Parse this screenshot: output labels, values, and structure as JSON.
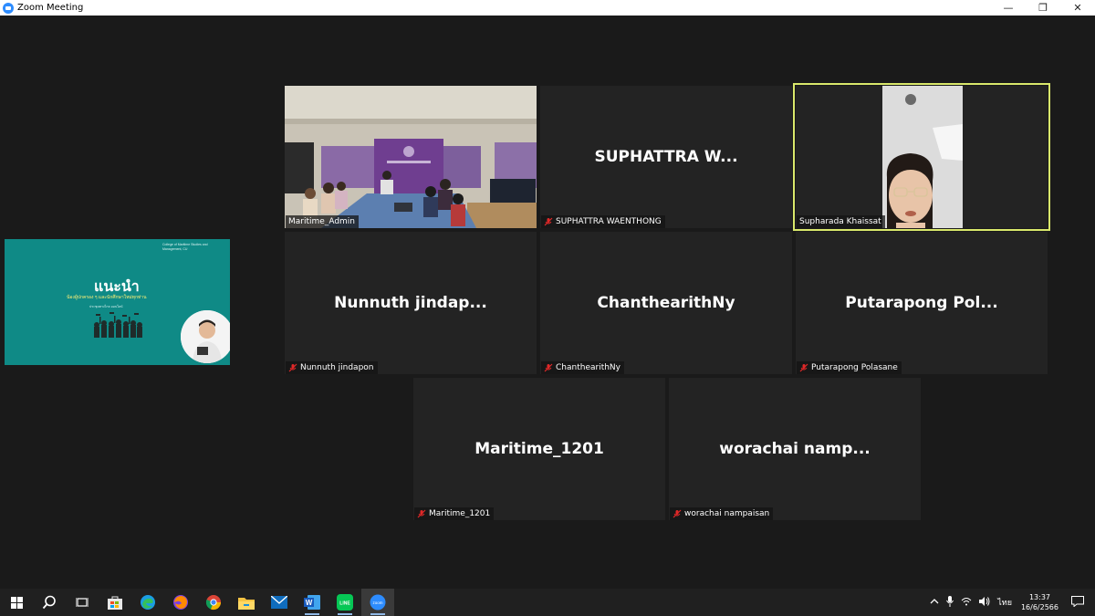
{
  "window": {
    "title": "Zoom Meeting",
    "minimize": "—",
    "restore": "❐",
    "close": "✕"
  },
  "shared_screen": {
    "org_text": "College of Maritime Studies and Management, CU",
    "heading": "แนะนำ",
    "subtitle": "น้องผู้ปกครอง ๆ และนักศึกษาใหม่ทุกท่าน",
    "small_text": "ประชุมทางไกล ออนไลน์"
  },
  "participants": [
    {
      "display": "",
      "name": "Maritime_Admin",
      "muted": false,
      "video": true
    },
    {
      "display": "SUPHATTRA  W...",
      "name": "SUPHATTRA WAENTHONG",
      "muted": true,
      "video": false
    },
    {
      "display": "",
      "name": "Supharada Khaissat",
      "muted": false,
      "video": true,
      "active": true
    },
    {
      "display": "Nunnuth  jindap...",
      "name": "Nunnuth jindapon",
      "muted": true,
      "video": false
    },
    {
      "display": "ChanthearithNy",
      "name": "ChanthearithNy",
      "muted": true,
      "video": false
    },
    {
      "display": "Putarapong  Pol...",
      "name": "Putarapong Polasane",
      "muted": true,
      "video": false
    },
    {
      "display": "Maritime_1201",
      "name": "Maritime_1201",
      "muted": true,
      "video": false
    },
    {
      "display": "worachai  namp...",
      "name": "worachai nampaisan",
      "muted": true,
      "video": false
    }
  ],
  "taskbar": {
    "icons": [
      "windows-start-icon",
      "search-icon",
      "task-view-icon",
      "store-icon",
      "edge-icon",
      "firefox-icon",
      "chrome-icon",
      "file-explorer-icon",
      "mail-icon",
      "word-icon",
      "line-icon",
      "zoom-icon"
    ],
    "word_letter": "W",
    "line_label": "LINE",
    "zoom_label": "zoom",
    "language": "ไทย",
    "time": "13:37",
    "date": "16/6/2566"
  },
  "colors": {
    "zoom_blue": "#2d8cff",
    "active_speaker": "#d9e86b",
    "muted_red": "#e02828",
    "slide_teal": "#0f8a86"
  }
}
